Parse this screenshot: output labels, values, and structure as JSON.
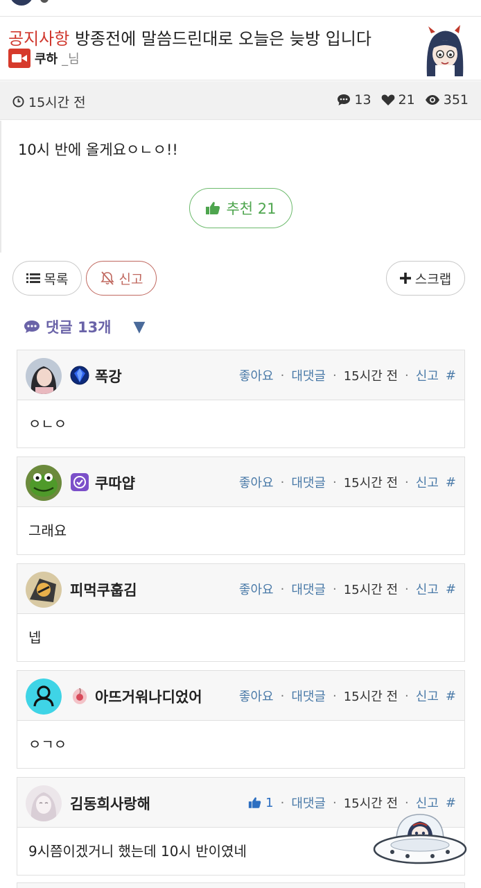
{
  "post": {
    "category": "공지사항",
    "title": " 방종전에 말씀드린대로 오늘은 늦방 입니다",
    "author": "쿠하",
    "author_suffix": "_님",
    "time": "15시간 전",
    "comment_count": "13",
    "like_count": "21",
    "view_count": "351",
    "body": "10시 반에 올게요ㅇㄴㅇ!!",
    "recommend_label": "추천 21"
  },
  "buttons": {
    "list_label": "목록",
    "report_label": "신고",
    "scrap_label": "스크랩"
  },
  "comments_header": {
    "label": "댓글 13개",
    "toggle": "▼"
  },
  "comment_actions": {
    "like": "좋아요",
    "reply": "대댓글",
    "report": "신고",
    "anchor": "#",
    "separator": "·"
  },
  "comments": [
    {
      "name": "폭강",
      "time": "15시간 전",
      "text": "ㅇㄴㅇ",
      "likes": "",
      "avatar": "portrait-avatar",
      "badge": "sapphire-badge"
    },
    {
      "name": "쿠따얍",
      "time": "15시간 전",
      "text": "그래요",
      "likes": "",
      "avatar": "frog-avatar",
      "badge": "purple-check-badge"
    },
    {
      "name": "피먹쿠훕김",
      "time": "15시간 전",
      "text": "넵",
      "likes": "",
      "avatar": "cartoon-avatar",
      "badge": ""
    },
    {
      "name": "아뜨거워나디었어",
      "time": "15시간 전",
      "text": "ㅇㄱㅇ",
      "likes": "",
      "avatar": "default-user-avatar",
      "badge": "peach-badge"
    },
    {
      "name": "김동희사랑해",
      "time": "15시간 전",
      "text": "9시쯤이겠거니 했는데 10시  반이였네",
      "likes": "1",
      "avatar": "sketch-avatar",
      "badge": ""
    }
  ],
  "colors": {
    "category_red": "#d0382e",
    "recommend_green": "#4ea54e",
    "comment_header_purple": "#6a63a8",
    "action_blue": "#4a7aa8",
    "report_red": "#c0685f"
  }
}
